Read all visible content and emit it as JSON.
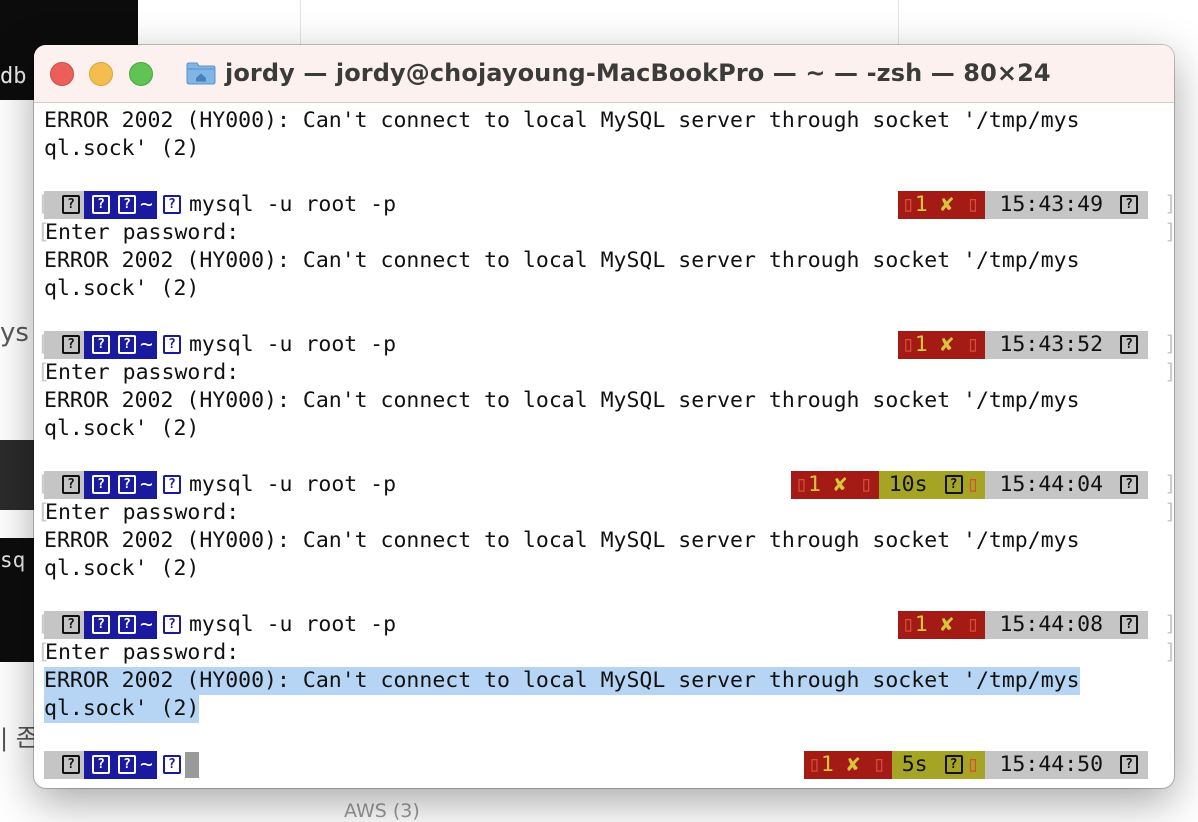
{
  "window": {
    "title": "jordy — jordy@chojayoung-MacBookPro — ~ — -zsh — 80×24"
  },
  "background": {
    "db_text": "db",
    "mys_text": "ys",
    "sq_text": "sq",
    "kr_text": "| 존",
    "aws_text": "AWS (3)"
  },
  "terminal": {
    "error_line1": "ERROR 2002 (HY000): Can't connect to local MySQL server through socket '/tmp/mys",
    "error_line2": "ql.sock' (2)",
    "command": "mysql -u root -p",
    "enter_password": "Enter password:",
    "prompt_dir": "~",
    "status_code": "1",
    "status_fail_mark": "✘",
    "glyph": "?",
    "times": [
      "15:43:49",
      "15:43:52",
      "15:44:04",
      "15:44:08",
      "15:44:50"
    ],
    "durations": {
      "p3": "10s",
      "p5": "5s"
    }
  }
}
